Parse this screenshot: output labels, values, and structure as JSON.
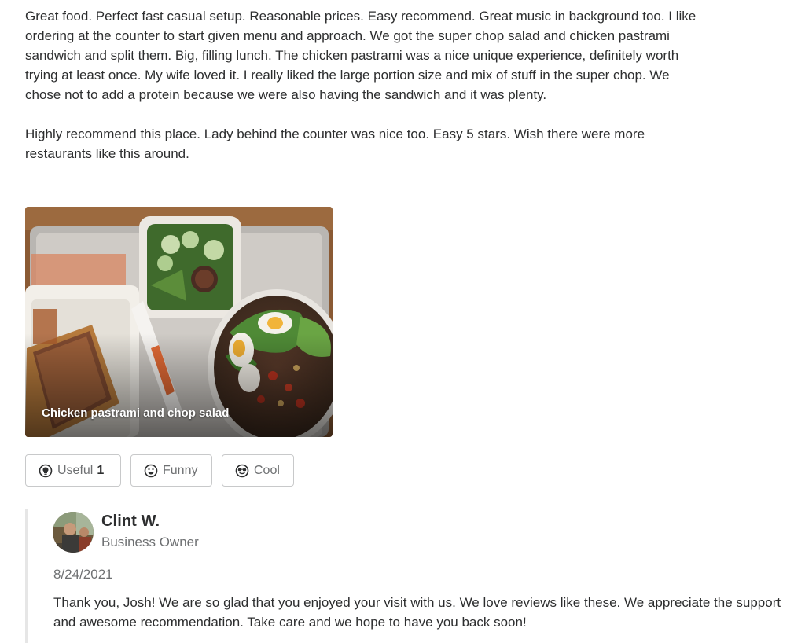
{
  "review": {
    "paragraphs": [
      "Great food. Perfect fast casual setup. Reasonable prices. Easy recommend. Great music in background too. I like ordering at the counter to start given menu and approach. We got the super chop salad and chicken pastrami sandwich and split them. Big, filling lunch. The chicken pastrami was a nice unique experience, definitely worth trying at least once. My wife loved it. I really liked the large portion size and mix of stuff in the super chop. We chose not to add a protein because we were also having the sandwich and it was plenty.",
      "Highly recommend this place. Lady behind the counter was nice too. Easy 5 stars. Wish there were more restaurants like this around."
    ],
    "photo_caption": "Chicken pastrami and chop salad"
  },
  "reactions": {
    "useful": {
      "label": "Useful",
      "count": "1",
      "icon": "lightbulb-icon"
    },
    "funny": {
      "label": "Funny",
      "icon": "smiley-icon"
    },
    "cool": {
      "label": "Cool",
      "icon": "sunglasses-icon"
    }
  },
  "owner_reply": {
    "name": "Clint W.",
    "role": "Business Owner",
    "date": "8/24/2021",
    "text": "Thank you, Josh! We are so glad that you enjoyed your visit with us. We love reviews like these. We appreciate the support and awesome recommendation. Take care and we hope to have you back soon!"
  },
  "colors": {
    "text": "#2d2e2f",
    "muted": "#6e7072",
    "border": "#c8c9ca",
    "reply_bar": "#e6e6e6"
  }
}
